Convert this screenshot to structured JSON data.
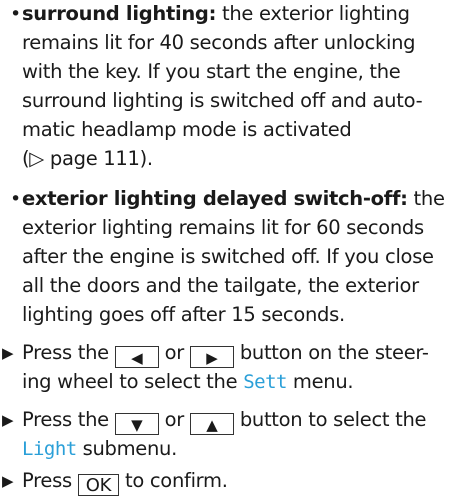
{
  "bullets": [
    {
      "term": "surround lighting:",
      "lines": [
        " the exterior lighting",
        "remains lit for 40 seconds after unlocking",
        "with the key. If you start the engine, the",
        "surround lighting is switched off and auto-",
        "matic headlamp mode is activated",
        "(▷ page 111)."
      ]
    },
    {
      "term": "exterior lighting delayed switch-off:",
      "lines": [
        " the",
        "exterior lighting remains lit for 60 seconds",
        "after the engine is switched off. If you close",
        "all the doors and the tailgate, the exterior",
        "lighting goes off after 15 seconds."
      ]
    }
  ],
  "steps": {
    "step1": {
      "press": "Press the",
      "key_left": "◀",
      "or": "or",
      "key_right": "▶",
      "rest1": "button on the steer-",
      "line2a": "ing wheel to select the",
      "menu": "Sett",
      "line2b": "menu."
    },
    "step2": {
      "press": "Press the",
      "key_down": "▼",
      "or": "or",
      "key_up": "▲",
      "rest1": "button to select the",
      "submenu": "Light",
      "line2b": "submenu."
    },
    "step3": {
      "press": "Press",
      "key_ok": "OK",
      "rest": "to confirm."
    }
  },
  "colors": {
    "accent": "#2a9fd8",
    "text": "#1a1a1a"
  }
}
